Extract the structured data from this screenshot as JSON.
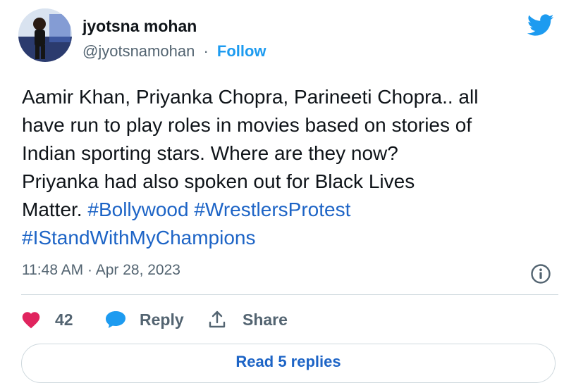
{
  "author": {
    "display_name": "jyotsna mohan",
    "handle": "@jyotsnamohan",
    "separator": "·",
    "follow_label": "Follow"
  },
  "tweet": {
    "line1": "Aamir Khan, Priyanka Chopra, Parineeti Chopra.. all",
    "line2": "have run to play roles in movies based on stories of",
    "line3": "Indian sporting stars. Where are they now?",
    "line4": "Priyanka had also spoken out for Black Lives",
    "line5_text": "Matter. ",
    "hashtags": [
      "#Bollywood",
      "#WrestlersProtest",
      "#IStandWithMyChampions"
    ]
  },
  "meta": {
    "time": "11:48 AM",
    "separator": "·",
    "date": "Apr 28, 2023"
  },
  "actions": {
    "like_count": "42",
    "reply_label": "Reply",
    "share_label": "Share"
  },
  "replies_button": "Read 5 replies",
  "icons": {
    "brand": "twitter-bird-icon",
    "like": "heart-icon",
    "reply": "speech-bubble-icon",
    "share": "share-upload-icon",
    "info": "info-icon"
  },
  "colors": {
    "link": "#1d64c6",
    "brand_blue": "#1d9bf0",
    "heart": "#e0245e",
    "muted": "#536471"
  }
}
